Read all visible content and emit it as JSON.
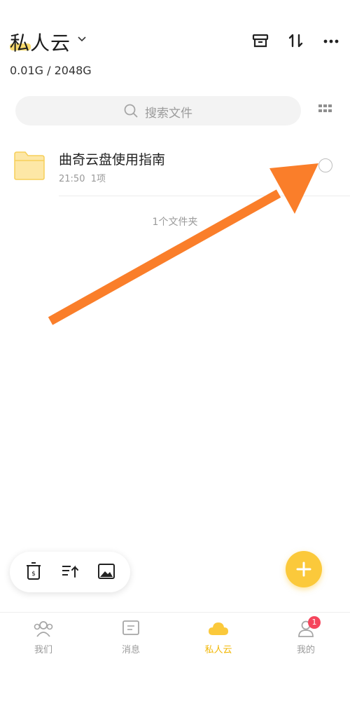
{
  "header": {
    "title": "私人云",
    "storage": "0.01G / 2048G"
  },
  "search": {
    "placeholder": "搜索文件"
  },
  "files": [
    {
      "name": "曲奇云盘使用指南",
      "time": "21:50",
      "items": "1项"
    }
  ],
  "folder_count": "1个文件夹",
  "nav": {
    "items": [
      {
        "label": "我们",
        "active": false
      },
      {
        "label": "消息",
        "active": false
      },
      {
        "label": "私人云",
        "active": true
      },
      {
        "label": "我的",
        "active": false
      }
    ],
    "badge": "1"
  },
  "colors": {
    "accent": "#fbc93b",
    "annotation_arrow": "#fa7e2a",
    "badge": "#f5455c"
  }
}
